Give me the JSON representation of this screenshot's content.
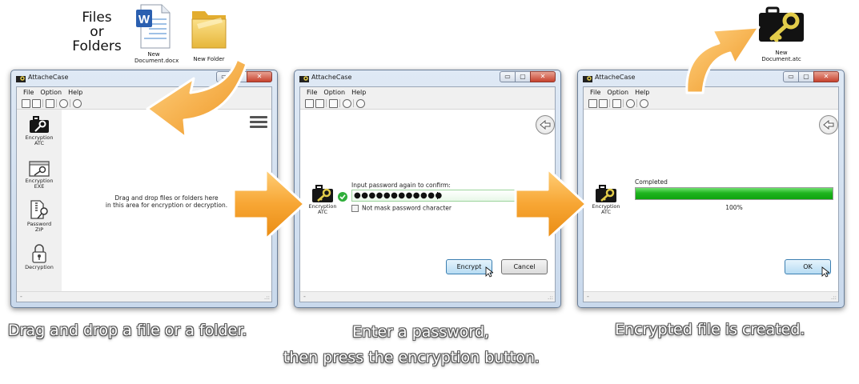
{
  "top": {
    "files_or_folders_label": [
      "Files",
      "or",
      "Folders"
    ],
    "doc_name": "New Document.docx",
    "doc_badge": "W",
    "folder_name": "New Folder",
    "atc_name": "New Document.atc"
  },
  "window": {
    "title": "AttacheCase",
    "menu": {
      "file": "File",
      "option": "Option",
      "help": "Help"
    },
    "controls": {
      "minimize": "▭",
      "maximize": "▢",
      "close": "✕"
    },
    "status_dash": "-",
    "grip": ".::"
  },
  "panel1": {
    "sidebar": [
      {
        "label1": "Encryption",
        "label2": "ATC",
        "icon": "briefcase-key-icon"
      },
      {
        "label1": "Encryption",
        "label2": "EXE",
        "icon": "exe-key-icon"
      },
      {
        "label1": "Password",
        "label2": "ZIP",
        "icon": "zip-key-icon"
      },
      {
        "label1": "Decryption",
        "label2": "",
        "icon": "padlock-icon"
      }
    ],
    "drop_text_line1": "Drag and drop files or folders here",
    "drop_text_line2": "in this area for encryption or decryption."
  },
  "panel2": {
    "icon_label1": "Encryption",
    "icon_label2": "ATC",
    "prompt": "Input password again to confirm:",
    "password_mask": "●●●●●●●●●●●●",
    "checkbox_label": "Not mask password character",
    "checkbox_checked": false,
    "encrypt_button": "Encrypt",
    "cancel_button": "Cancel"
  },
  "panel3": {
    "icon_label1": "Encryption",
    "icon_label2": "ATC",
    "status": "Completed",
    "progress_percent": 100,
    "progress_text": "100%",
    "ok_button": "OK"
  },
  "captions": {
    "step1": "Drag and drop a file or a folder.",
    "step2_line1": "Enter a password,",
    "step2_line2": "then press the encryption button.",
    "step3": "Encrypted file is created."
  },
  "colors": {
    "progress": "#22c022",
    "arrow": "#f6a431",
    "key": "#e2cc4a"
  }
}
